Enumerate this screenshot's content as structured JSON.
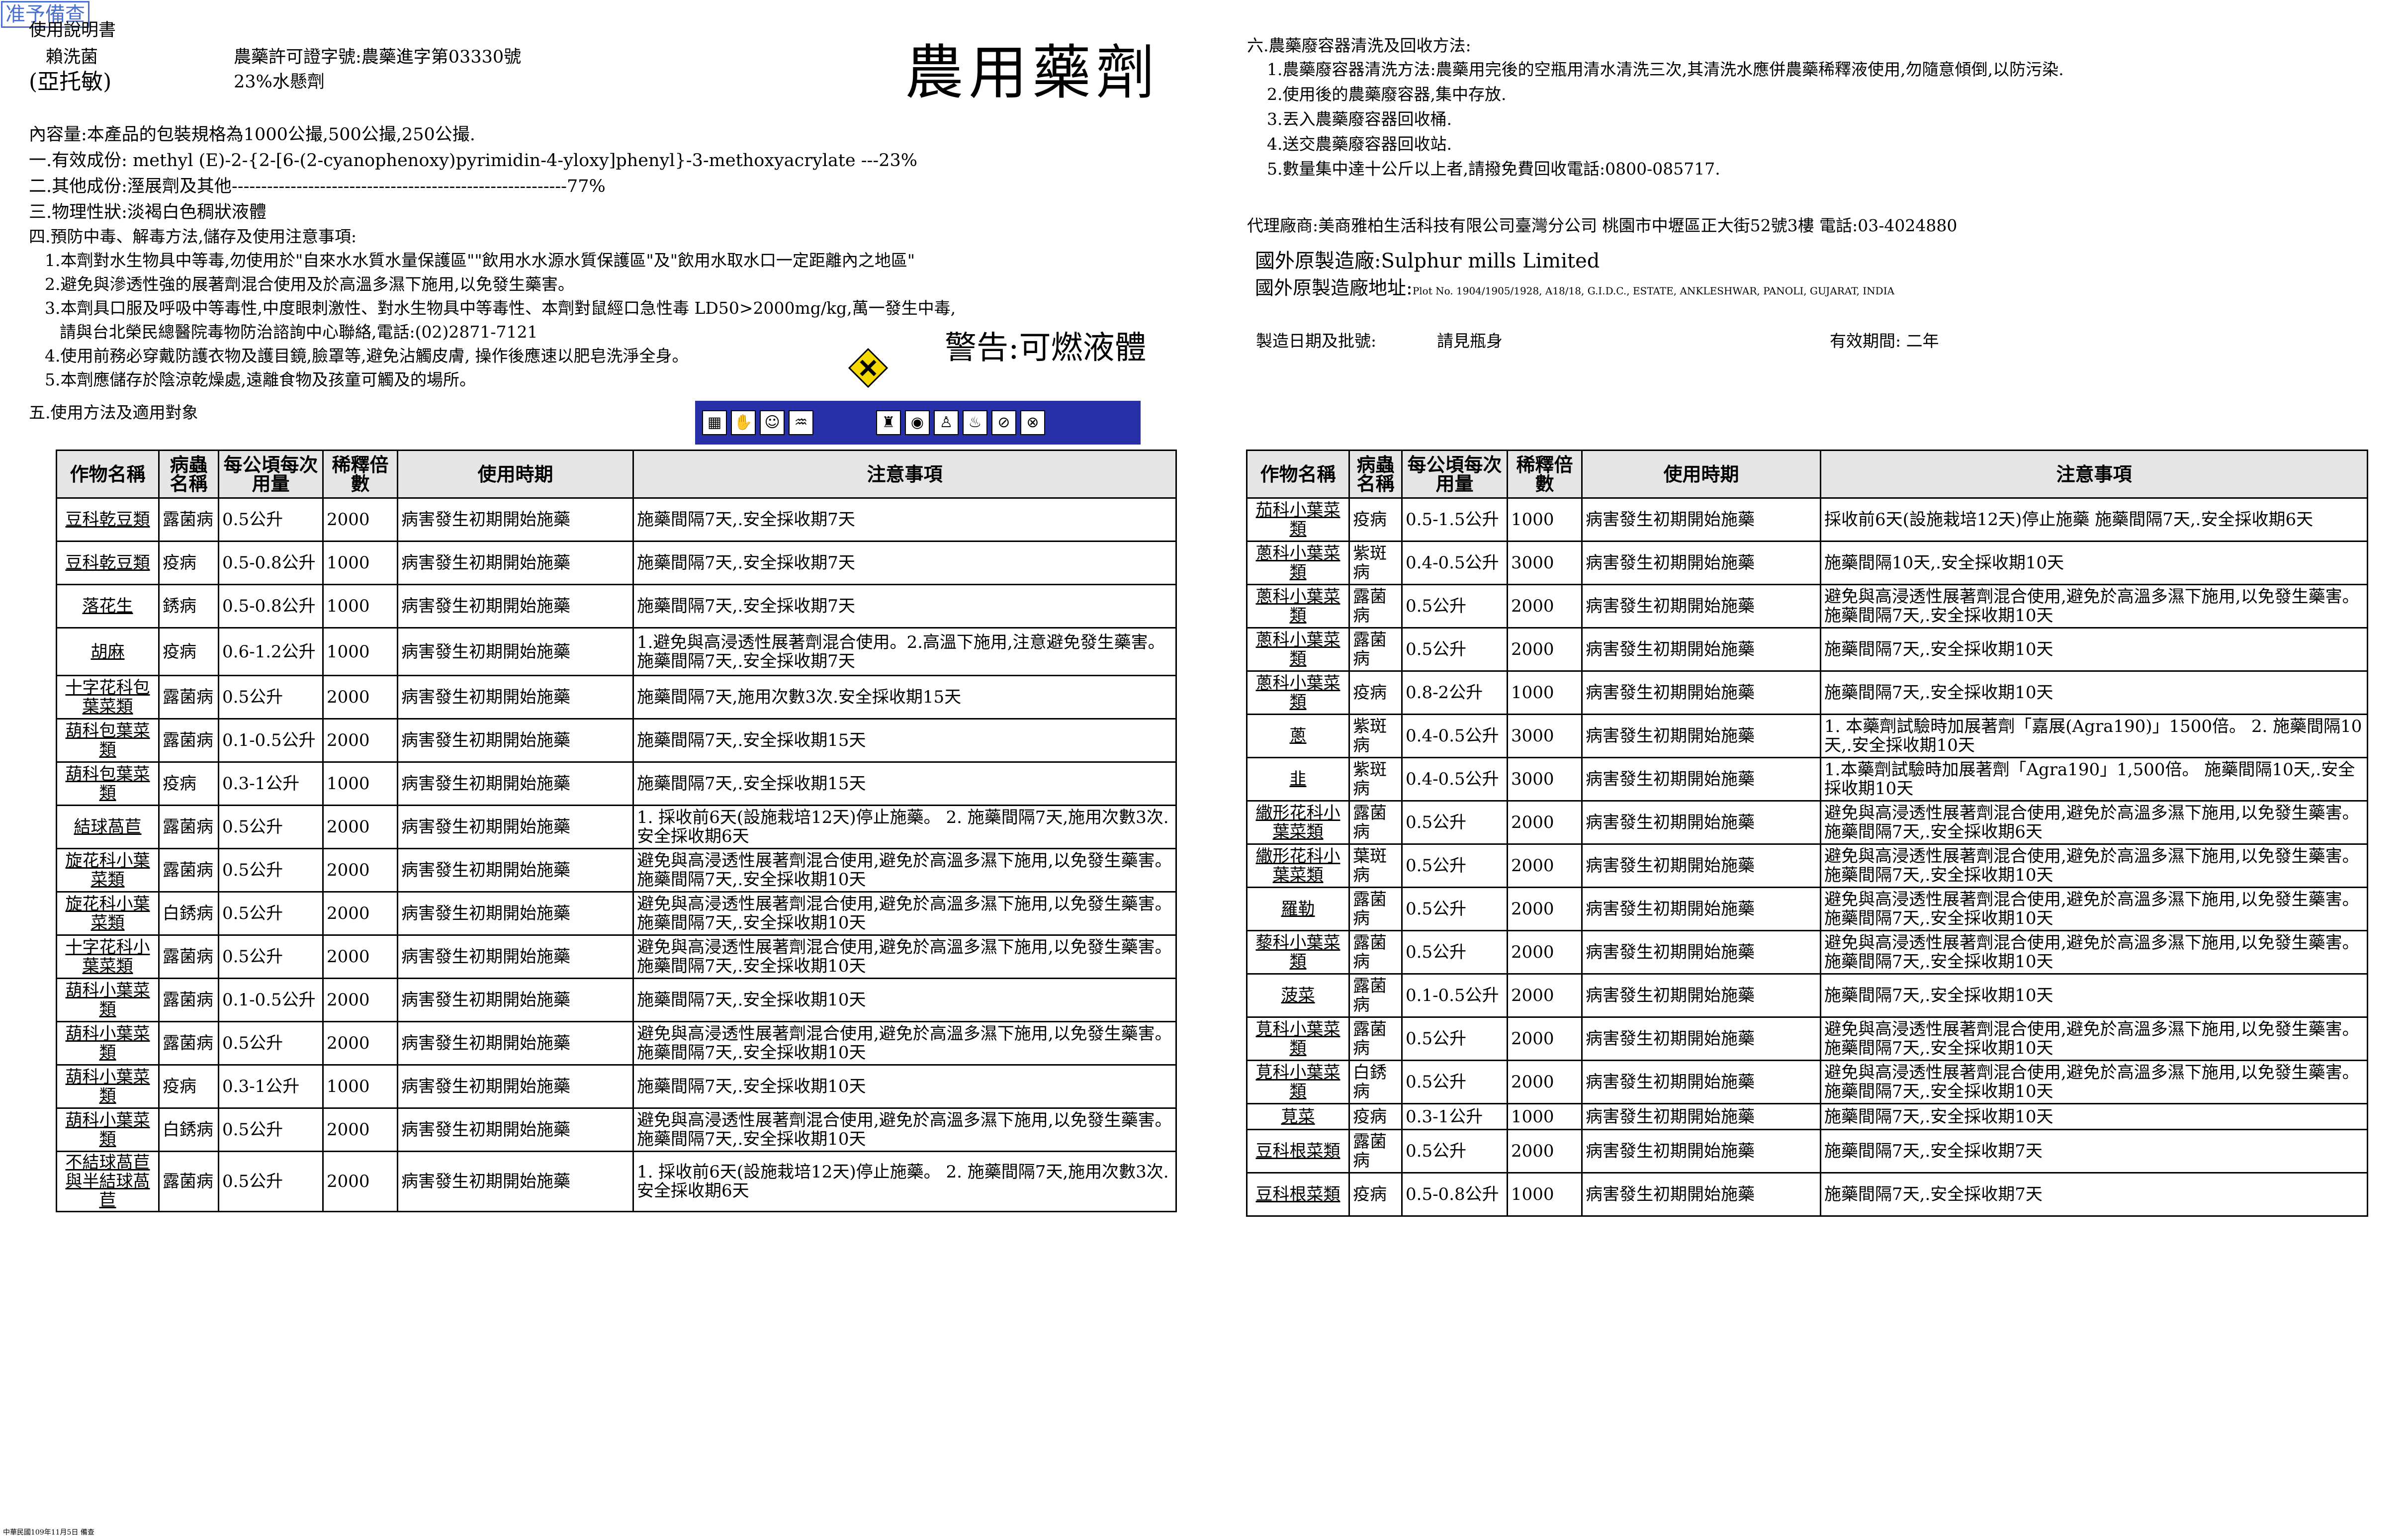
{
  "stamp": "准予備查",
  "title": "農用藥劑",
  "header": {
    "manual": "使用說明書",
    "product": "賴洗菌",
    "common_name": "(亞托敏)",
    "permit": "農藥許可證字號:農藥進字第03330號",
    "formulation": "23%水懸劑"
  },
  "body": {
    "content": "內容量:本產品的包裝規格為1000公撮,500公撮,250公撮.",
    "ingredient1": "一.有效成份: methyl (E)-2-{2-[6-(2-cyanophenoxy)pyrimidin-4-yloxy]phenyl}-3-methoxyacrylate ---23%",
    "ingredient2": "二.其他成份:溼展劑及其他---------------------------------------------------------77%",
    "physical": "三.物理性狀:淡褐白色稠狀液體",
    "precaution_head": "四.預防中毒、解毒方法,儲存及使用注意事項:",
    "p1": "1.本劑對水生物具中等毒,勿使用於\"自來水水質水量保護區\"\"飲用水水源水質保護區\"及\"飲用水取水口一定距離內之地區\"",
    "p2": "2.避免與滲透性強的展著劑混合使用及於高溫多濕下施用,以免發生藥害。",
    "p3": "3.本劑具口服及呼吸中等毒性,中度眼刺激性、對水生物具中等毒性、本劑對鼠經口急性毒 LD50>2000mg/kg,萬一發生中毒,",
    "p3b": "請與台北榮民總醫院毒物防治諮詢中心聯絡,電話:(02)2871-7121",
    "p4": "4.使用前務必穿戴防護衣物及護目鏡,臉罩等,避免沾觸皮膚, 操作後應速以肥皂洗淨全身。",
    "p5": "5.本劑應儲存於陰涼乾燥處,遠離食物及孩童可觸及的場所。",
    "usage_head": "五.使用方法及適用對象",
    "warning": "警告:可燃液體"
  },
  "right": {
    "recycle_head": "六.農藥廢容器清洗及回收方法:",
    "r1": "1.農藥廢容器清洗方法:農藥用完後的空瓶用清水清洗三次,其清洗水應併農藥稀釋液使用,勿隨意傾倒,以防污染.",
    "r2": "2.使用後的農藥廢容器,集中存放.",
    "r3": "3.丟入農藥廢容器回收桶.",
    "r4": "4.送交農藥廢容器回收站.",
    "r5": "5.數量集中達十公斤以上者,請撥免費回收電話:0800-085717.",
    "agent": "代理廠商:美商雅柏生活科技有限公司臺灣分公司   桃園市中壢區正大街52號3樓  電話:03-4024880",
    "maker": "國外原製造廠:Sulphur mills Limited",
    "maker_addr_label": "國外原製造廠地址:",
    "maker_addr": "Plot No. 1904/1905/1928, A18/18, G.I.D.C., ESTATE, ANKLESHWAR, PANOLI, GUJARAT, INDIA",
    "mfg_label": "製造日期及批號:",
    "mfg_value": "請見瓶身",
    "expiry": "有效期間: 二年"
  },
  "icons": {
    "hazard": "flammable-hazard-icon",
    "left_group": [
      "storage-icon",
      "gloves-icon",
      "mask-icon",
      "wash-icon"
    ],
    "right_group": [
      "boots-icon",
      "goggles-icon",
      "coverall-icon",
      "wash-hands-icon",
      "no-fish-icon",
      "no-animal-icon"
    ]
  },
  "table_headers": [
    "作物名稱",
    "病蟲名稱",
    "每公頃每次用量",
    "稀釋倍數",
    "使用時期",
    "注意事項"
  ],
  "left_table": [
    [
      "豆科乾豆類",
      "露菌病",
      "0.5公升",
      "2000",
      "病害發生初期開始施藥",
      "施藥間隔7天,.安全採收期7天"
    ],
    [
      "豆科乾豆類",
      "疫病",
      "0.5-0.8公升",
      "1000",
      "病害發生初期開始施藥",
      "施藥間隔7天,.安全採收期7天"
    ],
    [
      "落花生",
      "銹病",
      "0.5-0.8公升",
      "1000",
      "病害發生初期開始施藥",
      "施藥間隔7天,.安全採收期7天"
    ],
    [
      "胡麻",
      "疫病",
      "0.6-1.2公升",
      "1000",
      "病害發生初期開始施藥",
      "1.避免與高浸透性展著劑混合使用。2.高溫下施用,注意避免發生藥害。 施藥間隔7天,.安全採收期7天"
    ],
    [
      "十字花科包葉菜類",
      "露菌病",
      "0.5公升",
      "2000",
      "病害發生初期開始施藥",
      "施藥間隔7天,施用次數3次.安全採收期15天"
    ],
    [
      "葫科包葉菜類",
      "露菌病",
      "0.1-0.5公升",
      "2000",
      "病害發生初期開始施藥",
      "施藥間隔7天,.安全採收期15天"
    ],
    [
      "葫科包葉菜類",
      "疫病",
      "0.3-1公升",
      "1000",
      "病害發生初期開始施藥",
      "施藥間隔7天,.安全採收期15天"
    ],
    [
      "結球萵苣",
      "露菌病",
      "0.5公升",
      "2000",
      "病害發生初期開始施藥",
      "1. 採收前6天(設施栽培12天)停止施藥。 2. 施藥間隔7天,施用次數3次.安全採收期6天"
    ],
    [
      "旋花科小葉菜類",
      "露菌病",
      "0.5公升",
      "2000",
      "病害發生初期開始施藥",
      "避免與高浸透性展著劑混合使用,避免於高溫多濕下施用,以免發生藥害。施藥間隔7天,.安全採收期10天"
    ],
    [
      "旋花科小葉菜類",
      "白銹病",
      "0.5公升",
      "2000",
      "病害發生初期開始施藥",
      "避免與高浸透性展著劑混合使用,避免於高溫多濕下施用,以免發生藥害。施藥間隔7天,.安全採收期10天"
    ],
    [
      "十字花科小葉菜類",
      "露菌病",
      "0.5公升",
      "2000",
      "病害發生初期開始施藥",
      "避免與高浸透性展著劑混合使用,避免於高溫多濕下施用,以免發生藥害。施藥間隔7天,.安全採收期10天"
    ],
    [
      "葫科小葉菜類",
      "露菌病",
      "0.1-0.5公升",
      "2000",
      "病害發生初期開始施藥",
      "施藥間隔7天,.安全採收期10天"
    ],
    [
      "葫科小葉菜類",
      "露菌病",
      "0.5公升",
      "2000",
      "病害發生初期開始施藥",
      "避免與高浸透性展著劑混合使用,避免於高溫多濕下施用,以免發生藥害。施藥間隔7天,.安全採收期10天"
    ],
    [
      "葫科小葉菜類",
      "疫病",
      "0.3-1公升",
      "1000",
      "病害發生初期開始施藥",
      "施藥間隔7天,.安全採收期10天"
    ],
    [
      "葫科小葉菜類",
      "白銹病",
      "0.5公升",
      "2000",
      "病害發生初期開始施藥",
      "避免與高浸透性展著劑混合使用,避免於高溫多濕下施用,以免發生藥害。施藥間隔7天,.安全採收期10天"
    ],
    [
      "不結球萵苣與半結球萵苣",
      "露菌病",
      "0.5公升",
      "2000",
      "病害發生初期開始施藥",
      "1. 採收前6天(設施栽培12天)停止施藥。 2. 施藥間隔7天,施用次數3次.安全採收期6天"
    ]
  ],
  "right_table": [
    [
      "茄科小葉菜類",
      "疫病",
      "0.5-1.5公升",
      "1000",
      "病害發生初期開始施藥",
      "採收前6天(設施栽培12天)停止施藥 施藥間隔7天,.安全採收期6天"
    ],
    [
      "蔥科小葉菜類",
      "紫斑病",
      "0.4-0.5公升",
      "3000",
      "病害發生初期開始施藥",
      "施藥間隔10天,.安全採收期10天"
    ],
    [
      "蔥科小葉菜類",
      "露菌病",
      "0.5公升",
      "2000",
      "病害發生初期開始施藥",
      "避免與高浸透性展著劑混合使用,避免於高溫多濕下施用,以免發生藥害。施藥間隔7天,.安全採收期10天"
    ],
    [
      "蔥科小葉菜類",
      "露菌病",
      "0.5公升",
      "2000",
      "病害發生初期開始施藥",
      "施藥間隔7天,.安全採收期10天"
    ],
    [
      "蔥科小葉菜類",
      "疫病",
      "0.8-2公升",
      "1000",
      "病害發生初期開始施藥",
      "施藥間隔7天,.安全採收期10天"
    ],
    [
      "蔥",
      "紫斑病",
      "0.4-0.5公升",
      "3000",
      "病害發生初期開始施藥",
      "1. 本藥劑試驗時加展著劑「嘉展(Agra190)」1500倍。 2. 施藥間隔10天,.安全採收期10天"
    ],
    [
      "韭",
      "紫斑病",
      "0.4-0.5公升",
      "3000",
      "病害發生初期開始施藥",
      "1.本藥劑試驗時加展著劑「Agra190」1,500倍。 施藥間隔10天,.安全採收期10天"
    ],
    [
      "繖形花科小葉菜類",
      "露菌病",
      "0.5公升",
      "2000",
      "病害發生初期開始施藥",
      "避免與高浸透性展著劑混合使用,避免於高溫多濕下施用,以免發生藥害。施藥間隔7天,.安全採收期6天"
    ],
    [
      "繖形花科小葉菜類",
      "葉斑病",
      "0.5公升",
      "2000",
      "病害發生初期開始施藥",
      "避免與高浸透性展著劑混合使用,避免於高溫多濕下施用,以免發生藥害。施藥間隔7天,.安全採收期10天"
    ],
    [
      "羅勒",
      "露菌病",
      "0.5公升",
      "2000",
      "病害發生初期開始施藥",
      "避免與高浸透性展著劑混合使用,避免於高溫多濕下施用,以免發生藥害。施藥間隔7天,.安全採收期10天"
    ],
    [
      "藜科小葉菜類",
      "露菌病",
      "0.5公升",
      "2000",
      "病害發生初期開始施藥",
      "避免與高浸透性展著劑混合使用,避免於高溫多濕下施用,以免發生藥害。施藥間隔7天,.安全採收期10天"
    ],
    [
      "菠菜",
      "露菌病",
      "0.1-0.5公升",
      "2000",
      "病害發生初期開始施藥",
      "施藥間隔7天,.安全採收期10天"
    ],
    [
      "莧科小葉菜類",
      "露菌病",
      "0.5公升",
      "2000",
      "病害發生初期開始施藥",
      "避免與高浸透性展著劑混合使用,避免於高溫多濕下施用,以免發生藥害。施藥間隔7天,.安全採收期10天"
    ],
    [
      "莧科小葉菜類",
      "白銹病",
      "0.5公升",
      "2000",
      "病害發生初期開始施藥",
      "避免與高浸透性展著劑混合使用,避免於高溫多濕下施用,以免發生藥害。施藥間隔7天,.安全採收期10天"
    ],
    [
      "莧菜",
      "疫病",
      "0.3-1公升",
      "1000",
      "病害發生初期開始施藥",
      "施藥間隔7天,.安全採收期10天"
    ],
    [
      "豆科根菜類",
      "露菌病",
      "0.5公升",
      "2000",
      "病害發生初期開始施藥",
      "施藥間隔7天,.安全採收期7天"
    ],
    [
      "豆科根菜類",
      "疫病",
      "0.5-0.8公升",
      "1000",
      "病害發生初期開始施藥",
      "施藥間隔7天,.安全採收期7天"
    ]
  ],
  "footer": "中華民國109年11月5日 備查"
}
